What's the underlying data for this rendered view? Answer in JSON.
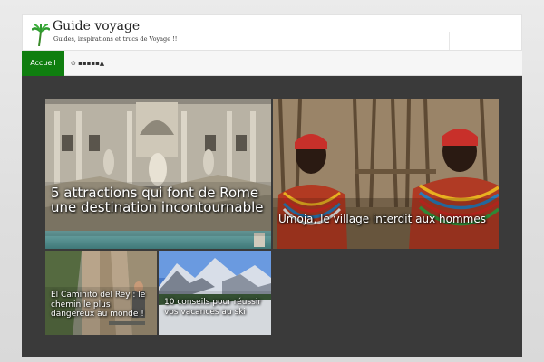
{
  "header": {
    "site_title": "Guide voyage",
    "tagline": "Guides, inspirations et trucs de Voyage !!",
    "logo_icon": "palm-tree-icon"
  },
  "nav": {
    "items": [
      {
        "label": "Accueil",
        "active": true
      }
    ],
    "extra_label": "⊙ ▪▪▪▪▪▲"
  },
  "colors": {
    "accent": "#0f7e0f",
    "content_bg": "#3a3a3a",
    "page_bg": "#e4e4e4"
  },
  "articles": [
    {
      "title": "5 attractions qui font de Rome une destination incontournable",
      "image": "trevi-fountain-rome"
    },
    {
      "title": "Umoja, le village interdit aux hommes",
      "image": "samburu-women-beaded-necklaces"
    },
    {
      "title": "El Caminito del Rey : le chemin le plus dangereux au monde !",
      "image": "cliff-walkway-hiker"
    },
    {
      "title": "10 conseils pour réussir vos vacances au ski",
      "image": "snowy-mountain-ski-slope"
    }
  ]
}
